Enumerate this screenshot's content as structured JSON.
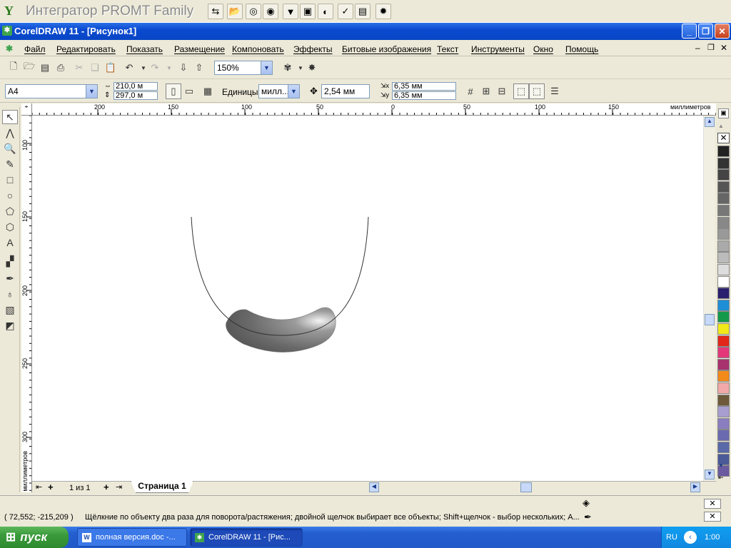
{
  "promt": {
    "title": "Интегратор PROMT Family"
  },
  "window": {
    "title": "CorelDRAW 11 - [Рисунок1]"
  },
  "menu": [
    "Файл",
    "Редактировать",
    "Показать",
    "Размещение",
    "Компоновать",
    "Эффекты",
    "Битовые изображения",
    "Текст",
    "Инструменты",
    "Окно",
    "Помощь"
  ],
  "toolbar": {
    "zoom": "150%"
  },
  "property_bar": {
    "page_size": "A4",
    "width": "210,0 м",
    "height": "297,0 м",
    "units_label": "Единицы:",
    "units_value": "милл...",
    "nudge": "2,54 мм",
    "dup_x": "6,35 мм",
    "dup_y": "6,35 мм"
  },
  "ruler_h": {
    "labels": [
      "200",
      "150",
      "100",
      "50",
      "0",
      "50",
      "100",
      "150"
    ],
    "unit": "миллиметров"
  },
  "ruler_v": {
    "labels": [
      "100",
      "150",
      "200",
      "250",
      "300"
    ],
    "unit": "миллиметров"
  },
  "page_nav": {
    "count": "1 из 1",
    "tab": "Страница 1"
  },
  "status": {
    "coords": "( 72,552; -215,209 )",
    "message": "Щёлкние по объекту два раза для поворота/растяжения; двойной щелчок выбирает все объекты; Shift+щелчок - выбор нескольких; A..."
  },
  "taskbar": {
    "start": "пуск",
    "tasks": [
      "полная версия.doc -...",
      "CorelDRAW 11 - [Рис..."
    ],
    "lang": "RU",
    "clock": "1:00"
  },
  "palette_colors": [
    "#222222",
    "#333333",
    "#444444",
    "#555555",
    "#666666",
    "#777777",
    "#888888",
    "#999999",
    "#aaaaaa",
    "#bbbbbb",
    "#dddddd",
    "#ffffff",
    "#2a1f6e",
    "#1e8fd6",
    "#129a4a",
    "#f2e81a",
    "#e3261a",
    "#e3387a",
    "#a8326e",
    "#f28a1a",
    "#f2a8a8",
    "#6e5a3a",
    "#a89ed0",
    "#8a7ec0",
    "#6a6ab0",
    "#5a6aa8",
    "#4a5a98",
    "#6a5aa0"
  ]
}
